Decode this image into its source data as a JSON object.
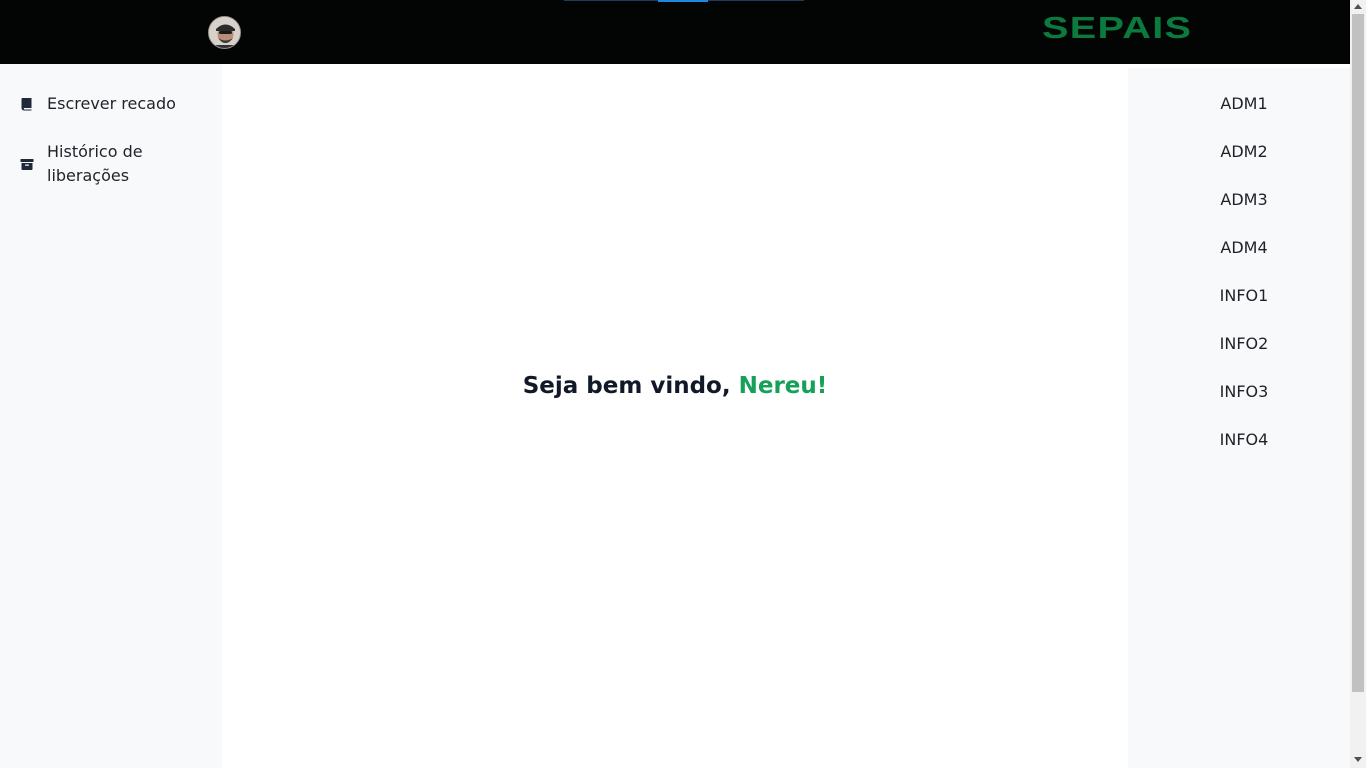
{
  "header": {
    "logo_text": "SEPAIS",
    "logo_color": "#0a7a3e",
    "background": "#030504"
  },
  "sidebar": {
    "items": [
      {
        "icon": "book-icon",
        "label": "Escrever recado"
      },
      {
        "icon": "archive-box-icon",
        "label": "Histórico de liberações"
      }
    ]
  },
  "main": {
    "greeting_prefix": "Seja bem vindo, ",
    "user_name": "Nereu!",
    "accent_color": "#16a058"
  },
  "rooms": {
    "items": [
      "ADM1",
      "ADM2",
      "ADM3",
      "ADM4",
      "INFO1",
      "INFO2",
      "INFO3",
      "INFO4"
    ]
  }
}
